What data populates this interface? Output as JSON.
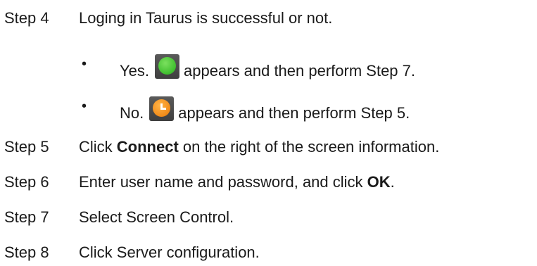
{
  "steps": [
    {
      "label": "Step 4",
      "text": "Loging in Taurus is successful or not."
    },
    {
      "label": "Step 5",
      "text_before": "Click ",
      "bold": "Connect",
      "text_after": " on the right of the screen information."
    },
    {
      "label": "Step 6",
      "text_before": "Enter user name and password, and click ",
      "bold": "OK",
      "text_after": "."
    },
    {
      "label": "Step 7",
      "text": "Select Screen Control."
    },
    {
      "label": "Step 8",
      "text": "Click Server configuration."
    }
  ],
  "bullets": [
    {
      "symbol": "•",
      "prefix": "Yes.",
      "icon": "green-status-icon",
      "icon_color": "#3fbf2f",
      "suffix": "appears and then perform Step 7."
    },
    {
      "symbol": "•",
      "prefix": "No.",
      "icon": "orange-clock-icon",
      "icon_color": "#f28c1a",
      "suffix": "appears and then perform Step 5."
    }
  ]
}
